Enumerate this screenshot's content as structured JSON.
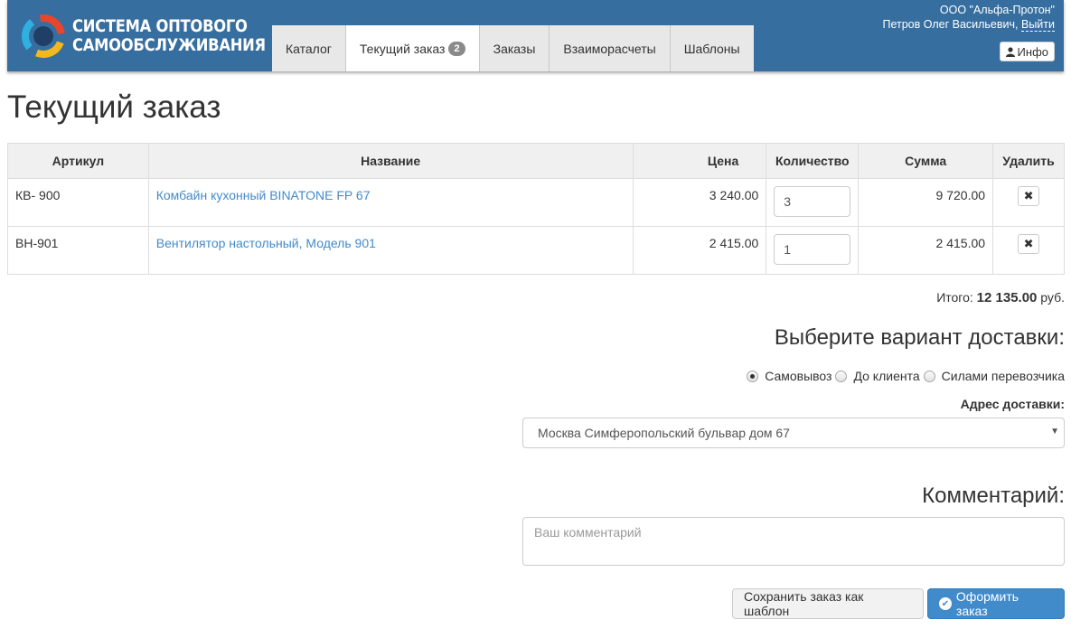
{
  "app": {
    "logo_line1": "СИСТЕМА ОПТОВОГО",
    "logo_line2": "САМООБСЛУЖИВАНИЯ"
  },
  "nav": {
    "tabs": [
      {
        "label": "Каталог"
      },
      {
        "label": "Текущий заказ",
        "badge": "2",
        "active": true
      },
      {
        "label": "Заказы"
      },
      {
        "label": "Взаиморасчеты"
      },
      {
        "label": "Шаблоны"
      }
    ]
  },
  "user": {
    "company": "ООО \"Альфа-Протон\"",
    "name": "Петров Олег Васильевич,",
    "logout": "Выйти",
    "info": "Инфо"
  },
  "page": {
    "title": "Текущий заказ"
  },
  "table": {
    "headers": [
      "Артикул",
      "Название",
      "Цена",
      "Количество",
      "Сумма",
      "Удалить"
    ],
    "rows": [
      {
        "sku": "КВ- 900",
        "name": "Комбайн кухонный BINATONE FP 67",
        "price": "3 240.00",
        "qty": "3",
        "sum": "9 720.00"
      },
      {
        "sku": "ВН-901",
        "name": "Вентилятор настольный, Модель 901",
        "price": "2 415.00",
        "qty": "1",
        "sum": "2 415.00"
      }
    ]
  },
  "total": {
    "label": "Итого:",
    "value": "12 135.00",
    "currency": "руб."
  },
  "delivery": {
    "title": "Выберите вариант доставки:",
    "options": [
      {
        "label": "Самовывоз",
        "checked": true
      },
      {
        "label": "До клиента",
        "checked": false
      },
      {
        "label": "Силами перевозчика",
        "checked": false
      }
    ],
    "address_label": "Адрес доставки:",
    "address_value": "Москва Симферопольский бульвар дом 67"
  },
  "comment": {
    "title": "Комментарий:",
    "placeholder": "Ваш комментарий"
  },
  "actions": {
    "save_template": "Сохранить заказ как шаблон",
    "submit": "Оформить заказ"
  },
  "colors": {
    "header": "#366e9f",
    "link": "#428bca",
    "primary": "#428bca"
  },
  "icons": {
    "info": "user-icon",
    "delete": "remove-icon",
    "submit": "ok-circle-icon",
    "select": "caret-down-icon"
  }
}
